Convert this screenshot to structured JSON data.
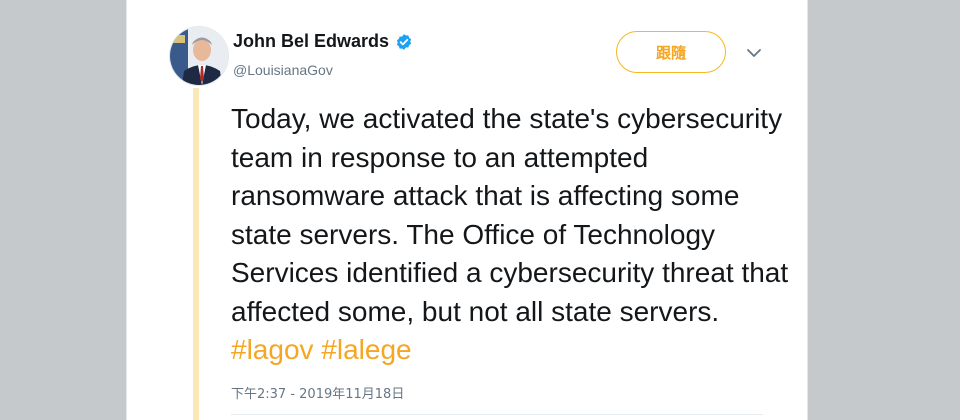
{
  "tweet": {
    "author": {
      "name": "John Bel Edwards",
      "handle": "@LouisianaGov",
      "verified": true,
      "avatar_icon": "person-avatar"
    },
    "follow_label": "跟隨",
    "menu_icon": "chevron-down-icon",
    "text_parts": [
      "Today, we activated the state's cybersecurity team in response to an attempted ransomware attack that is affecting some state servers. The Office of Technology Services identified a cybersecurity threat that affected some, but not all state servers. ",
      "#lagov",
      " ",
      "#lalege"
    ],
    "timestamp": "下午2:37 - 2019年11月18日"
  },
  "colors": {
    "accent": "#f5a623",
    "verified_badge": "#1da1f2",
    "thread_line": "#fce8b6",
    "background": "#c6c9cc"
  }
}
